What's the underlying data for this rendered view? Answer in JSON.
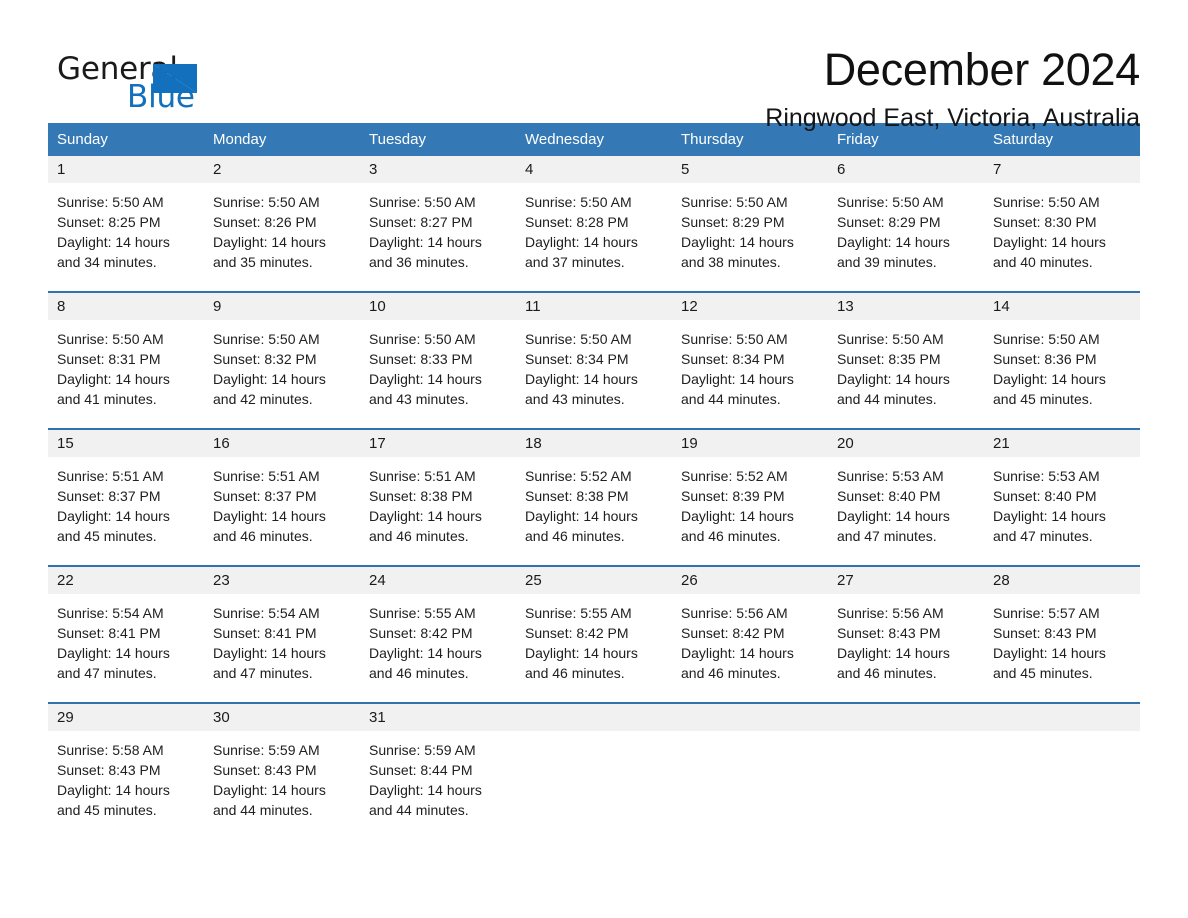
{
  "brand": {
    "word_one": "General",
    "word_two": "Blue",
    "triangle_color": "#1270bd",
    "text_color": "#1a1a1a"
  },
  "header": {
    "month_title": "December 2024",
    "location": "Ringwood East, Victoria, Australia"
  },
  "theme": {
    "header_row_bg": "#3479b5",
    "row_divider": "#2f72ae",
    "day_band_bg": "#f1f1f1",
    "page_bg": "#ffffff"
  },
  "weekdays": [
    "Sunday",
    "Monday",
    "Tuesday",
    "Wednesday",
    "Thursday",
    "Friday",
    "Saturday"
  ],
  "weeks": [
    [
      {
        "day": "1",
        "sunrise": "Sunrise: 5:50 AM",
        "sunset": "Sunset: 8:25 PM",
        "daylight_line1": "Daylight: 14 hours",
        "daylight_line2": "and 34 minutes."
      },
      {
        "day": "2",
        "sunrise": "Sunrise: 5:50 AM",
        "sunset": "Sunset: 8:26 PM",
        "daylight_line1": "Daylight: 14 hours",
        "daylight_line2": "and 35 minutes."
      },
      {
        "day": "3",
        "sunrise": "Sunrise: 5:50 AM",
        "sunset": "Sunset: 8:27 PM",
        "daylight_line1": "Daylight: 14 hours",
        "daylight_line2": "and 36 minutes."
      },
      {
        "day": "4",
        "sunrise": "Sunrise: 5:50 AM",
        "sunset": "Sunset: 8:28 PM",
        "daylight_line1": "Daylight: 14 hours",
        "daylight_line2": "and 37 minutes."
      },
      {
        "day": "5",
        "sunrise": "Sunrise: 5:50 AM",
        "sunset": "Sunset: 8:29 PM",
        "daylight_line1": "Daylight: 14 hours",
        "daylight_line2": "and 38 minutes."
      },
      {
        "day": "6",
        "sunrise": "Sunrise: 5:50 AM",
        "sunset": "Sunset: 8:29 PM",
        "daylight_line1": "Daylight: 14 hours",
        "daylight_line2": "and 39 minutes."
      },
      {
        "day": "7",
        "sunrise": "Sunrise: 5:50 AM",
        "sunset": "Sunset: 8:30 PM",
        "daylight_line1": "Daylight: 14 hours",
        "daylight_line2": "and 40 minutes."
      }
    ],
    [
      {
        "day": "8",
        "sunrise": "Sunrise: 5:50 AM",
        "sunset": "Sunset: 8:31 PM",
        "daylight_line1": "Daylight: 14 hours",
        "daylight_line2": "and 41 minutes."
      },
      {
        "day": "9",
        "sunrise": "Sunrise: 5:50 AM",
        "sunset": "Sunset: 8:32 PM",
        "daylight_line1": "Daylight: 14 hours",
        "daylight_line2": "and 42 minutes."
      },
      {
        "day": "10",
        "sunrise": "Sunrise: 5:50 AM",
        "sunset": "Sunset: 8:33 PM",
        "daylight_line1": "Daylight: 14 hours",
        "daylight_line2": "and 43 minutes."
      },
      {
        "day": "11",
        "sunrise": "Sunrise: 5:50 AM",
        "sunset": "Sunset: 8:34 PM",
        "daylight_line1": "Daylight: 14 hours",
        "daylight_line2": "and 43 minutes."
      },
      {
        "day": "12",
        "sunrise": "Sunrise: 5:50 AM",
        "sunset": "Sunset: 8:34 PM",
        "daylight_line1": "Daylight: 14 hours",
        "daylight_line2": "and 44 minutes."
      },
      {
        "day": "13",
        "sunrise": "Sunrise: 5:50 AM",
        "sunset": "Sunset: 8:35 PM",
        "daylight_line1": "Daylight: 14 hours",
        "daylight_line2": "and 44 minutes."
      },
      {
        "day": "14",
        "sunrise": "Sunrise: 5:50 AM",
        "sunset": "Sunset: 8:36 PM",
        "daylight_line1": "Daylight: 14 hours",
        "daylight_line2": "and 45 minutes."
      }
    ],
    [
      {
        "day": "15",
        "sunrise": "Sunrise: 5:51 AM",
        "sunset": "Sunset: 8:37 PM",
        "daylight_line1": "Daylight: 14 hours",
        "daylight_line2": "and 45 minutes."
      },
      {
        "day": "16",
        "sunrise": "Sunrise: 5:51 AM",
        "sunset": "Sunset: 8:37 PM",
        "daylight_line1": "Daylight: 14 hours",
        "daylight_line2": "and 46 minutes."
      },
      {
        "day": "17",
        "sunrise": "Sunrise: 5:51 AM",
        "sunset": "Sunset: 8:38 PM",
        "daylight_line1": "Daylight: 14 hours",
        "daylight_line2": "and 46 minutes."
      },
      {
        "day": "18",
        "sunrise": "Sunrise: 5:52 AM",
        "sunset": "Sunset: 8:38 PM",
        "daylight_line1": "Daylight: 14 hours",
        "daylight_line2": "and 46 minutes."
      },
      {
        "day": "19",
        "sunrise": "Sunrise: 5:52 AM",
        "sunset": "Sunset: 8:39 PM",
        "daylight_line1": "Daylight: 14 hours",
        "daylight_line2": "and 46 minutes."
      },
      {
        "day": "20",
        "sunrise": "Sunrise: 5:53 AM",
        "sunset": "Sunset: 8:40 PM",
        "daylight_line1": "Daylight: 14 hours",
        "daylight_line2": "and 47 minutes."
      },
      {
        "day": "21",
        "sunrise": "Sunrise: 5:53 AM",
        "sunset": "Sunset: 8:40 PM",
        "daylight_line1": "Daylight: 14 hours",
        "daylight_line2": "and 47 minutes."
      }
    ],
    [
      {
        "day": "22",
        "sunrise": "Sunrise: 5:54 AM",
        "sunset": "Sunset: 8:41 PM",
        "daylight_line1": "Daylight: 14 hours",
        "daylight_line2": "and 47 minutes."
      },
      {
        "day": "23",
        "sunrise": "Sunrise: 5:54 AM",
        "sunset": "Sunset: 8:41 PM",
        "daylight_line1": "Daylight: 14 hours",
        "daylight_line2": "and 47 minutes."
      },
      {
        "day": "24",
        "sunrise": "Sunrise: 5:55 AM",
        "sunset": "Sunset: 8:42 PM",
        "daylight_line1": "Daylight: 14 hours",
        "daylight_line2": "and 46 minutes."
      },
      {
        "day": "25",
        "sunrise": "Sunrise: 5:55 AM",
        "sunset": "Sunset: 8:42 PM",
        "daylight_line1": "Daylight: 14 hours",
        "daylight_line2": "and 46 minutes."
      },
      {
        "day": "26",
        "sunrise": "Sunrise: 5:56 AM",
        "sunset": "Sunset: 8:42 PM",
        "daylight_line1": "Daylight: 14 hours",
        "daylight_line2": "and 46 minutes."
      },
      {
        "day": "27",
        "sunrise": "Sunrise: 5:56 AM",
        "sunset": "Sunset: 8:43 PM",
        "daylight_line1": "Daylight: 14 hours",
        "daylight_line2": "and 46 minutes."
      },
      {
        "day": "28",
        "sunrise": "Sunrise: 5:57 AM",
        "sunset": "Sunset: 8:43 PM",
        "daylight_line1": "Daylight: 14 hours",
        "daylight_line2": "and 45 minutes."
      }
    ],
    [
      {
        "day": "29",
        "sunrise": "Sunrise: 5:58 AM",
        "sunset": "Sunset: 8:43 PM",
        "daylight_line1": "Daylight: 14 hours",
        "daylight_line2": "and 45 minutes."
      },
      {
        "day": "30",
        "sunrise": "Sunrise: 5:59 AM",
        "sunset": "Sunset: 8:43 PM",
        "daylight_line1": "Daylight: 14 hours",
        "daylight_line2": "and 44 minutes."
      },
      {
        "day": "31",
        "sunrise": "Sunrise: 5:59 AM",
        "sunset": "Sunset: 8:44 PM",
        "daylight_line1": "Daylight: 14 hours",
        "daylight_line2": "and 44 minutes."
      },
      {
        "day": "",
        "sunrise": "",
        "sunset": "",
        "daylight_line1": "",
        "daylight_line2": ""
      },
      {
        "day": "",
        "sunrise": "",
        "sunset": "",
        "daylight_line1": "",
        "daylight_line2": ""
      },
      {
        "day": "",
        "sunrise": "",
        "sunset": "",
        "daylight_line1": "",
        "daylight_line2": ""
      },
      {
        "day": "",
        "sunrise": "",
        "sunset": "",
        "daylight_line1": "",
        "daylight_line2": ""
      }
    ]
  ]
}
